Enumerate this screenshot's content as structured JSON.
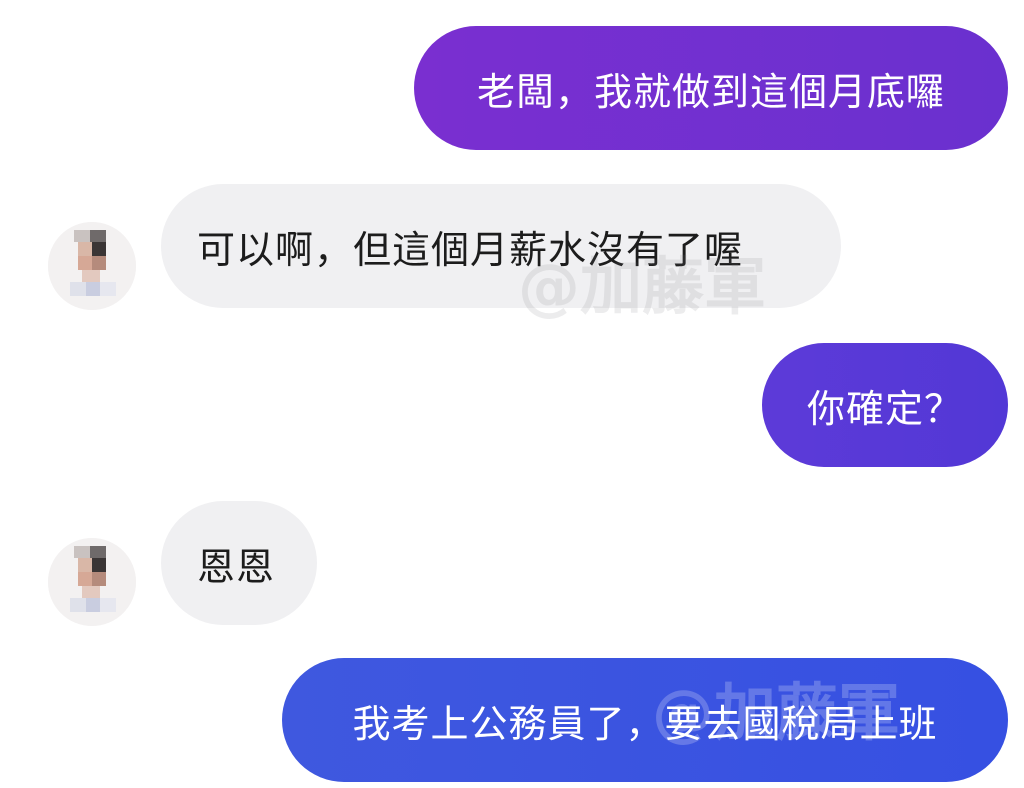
{
  "messages": [
    {
      "side": "outgoing",
      "text": "老闆，我就做到這個月底囉"
    },
    {
      "side": "incoming",
      "text": "可以啊，但這個月薪水沒有了喔"
    },
    {
      "side": "outgoing",
      "text": "你確定？"
    },
    {
      "side": "incoming",
      "text": "恩恩"
    },
    {
      "side": "outgoing",
      "text": "我考上公務員了，要去國稅局上班"
    }
  ],
  "watermark": "@加藤軍",
  "colors": {
    "outgoing_1": "#7a2fd0",
    "outgoing_2": "#5d3ad8",
    "outgoing_3": "#3f58df",
    "incoming_bg": "#f0f0f2"
  },
  "icons": {
    "avatar": "pixelated-avatar"
  }
}
